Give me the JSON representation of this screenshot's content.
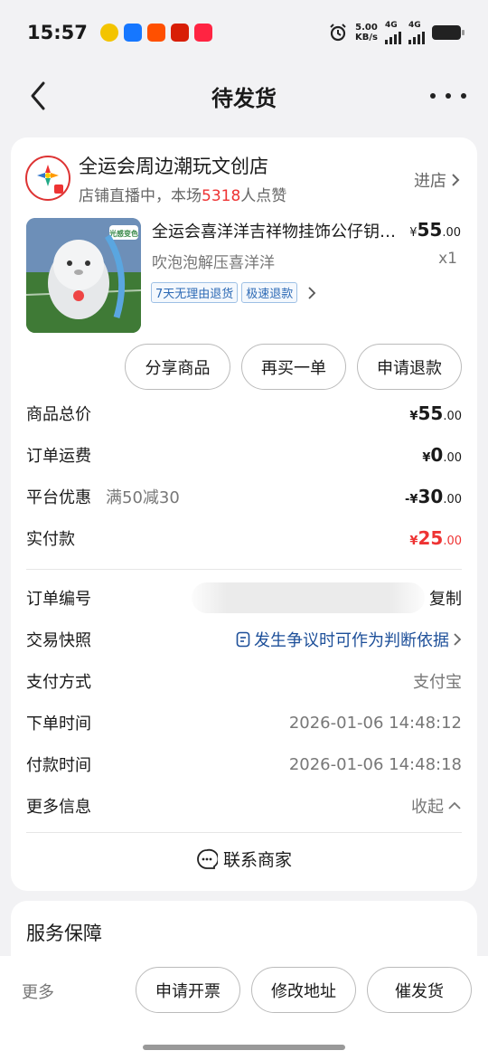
{
  "status_bar": {
    "time": "15:57",
    "net_speed_value": "5.00",
    "net_speed_unit": "KB/s",
    "sim1": "4G",
    "sim2": "4G"
  },
  "nav": {
    "title": "待发货"
  },
  "shop": {
    "name": "全运会周边潮玩文创店",
    "sub_prefix": "店铺直播中，本场",
    "likes": "5318",
    "sub_suffix": "人点赞",
    "enter_label": "进店"
  },
  "product": {
    "name": "全运会喜洋洋吉祥物挂饰公仔钥匙扣",
    "spec": "吹泡泡解压喜洋洋",
    "price_currency": "¥",
    "price_int": "55",
    "price_dec": ".00",
    "qty": "x1",
    "image_badge": "光感变色",
    "tags": [
      "7天无理由退货",
      "极速退款"
    ]
  },
  "actions": {
    "share": "分享商品",
    "rebuy": "再买一单",
    "refund": "申请退款"
  },
  "summary": {
    "total_label": "商品总价",
    "total_int": "55",
    "total_dec": ".00",
    "shipping_label": "订单运费",
    "shipping_int": "0",
    "shipping_dec": ".00",
    "discount_label": "平台优惠",
    "discount_desc": "满50减30",
    "discount_prefix": "-",
    "discount_int": "30",
    "discount_dec": ".00",
    "paid_label": "实付款",
    "paid_int": "25",
    "paid_dec": ".00",
    "currency": "¥"
  },
  "order_info": {
    "order_no_label": "订单编号",
    "copy_label": "复制",
    "snapshot_label": "交易快照",
    "snapshot_value": "发生争议时可作为判断依据",
    "pay_method_label": "支付方式",
    "pay_method_value": "支付宝",
    "order_time_label": "下单时间",
    "order_time_value": "2026-01-06 14:48:12",
    "pay_time_label": "付款时间",
    "pay_time_value": "2026-01-06 14:48:18",
    "more_info_label": "更多信息",
    "collapse_label": "收起"
  },
  "contact": {
    "label": "联系商家"
  },
  "service": {
    "title": "服务保障"
  },
  "bottom": {
    "more": "更多",
    "invoice": "申请开票",
    "address": "修改地址",
    "urge": "催发货"
  },
  "colors": {
    "price_red": "#e33333",
    "link_blue": "#1d4f99",
    "tag_blue": "#2d6ab5"
  }
}
